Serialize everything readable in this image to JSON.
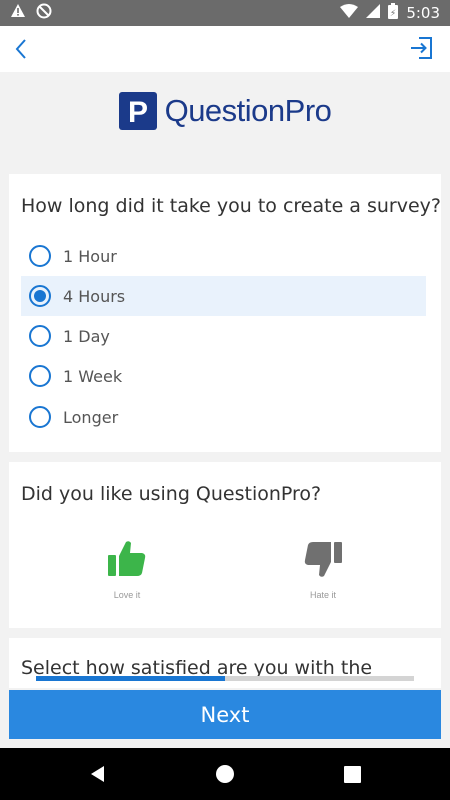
{
  "status_bar": {
    "time": "5:03",
    "battery_glyph": "⚡",
    "icons": [
      "warning-icon",
      "no-sync-icon",
      "wifi-icon",
      "signal-icon",
      "battery-icon"
    ]
  },
  "app_bar": {
    "back_icon": "chevron-left-icon",
    "exit_icon": "exit-icon",
    "accent_color": "#1976d2"
  },
  "brand": {
    "name": "QuestionPro",
    "logo_letter": "P",
    "color": "#1b3a8a"
  },
  "questions": [
    {
      "text": "How long did it take you to create a survey?",
      "options": [
        {
          "label": "1 Hour",
          "selected": false
        },
        {
          "label": "4 Hours",
          "selected": true
        },
        {
          "label": "1 Day",
          "selected": false
        },
        {
          "label": "1 Week",
          "selected": false
        },
        {
          "label": "Longer",
          "selected": false
        }
      ]
    },
    {
      "text": "Did you like using QuestionPro?",
      "thumbs": {
        "up": {
          "label": "Love it",
          "color": "#3cb54a"
        },
        "down": {
          "label": "Hate it",
          "color": "#707070"
        }
      }
    },
    {
      "text": "Select how satisfied are you with the"
    }
  ],
  "progress": {
    "fraction": 0.5
  },
  "footer": {
    "next_label": "Next"
  }
}
